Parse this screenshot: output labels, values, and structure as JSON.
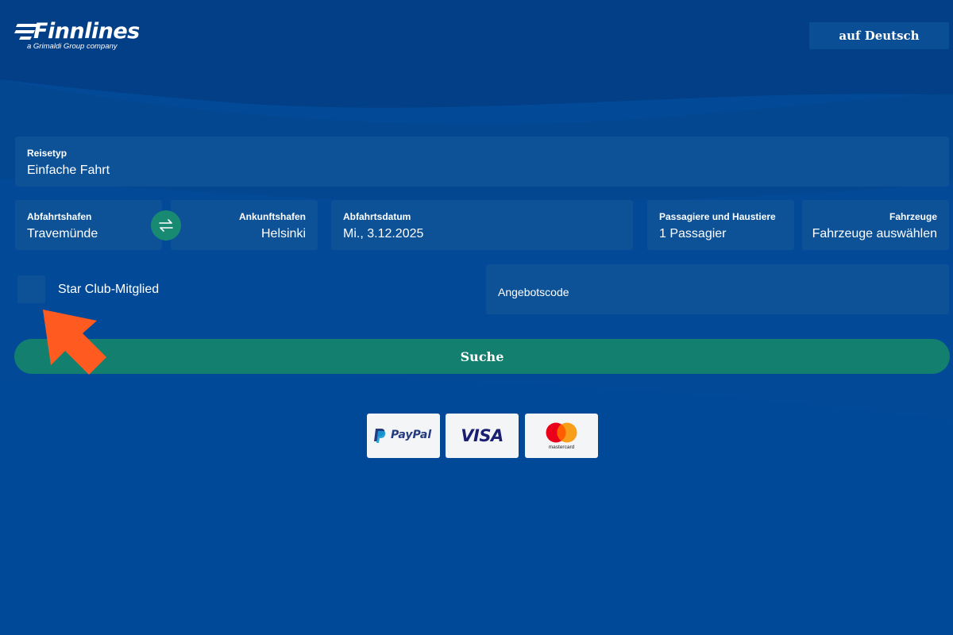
{
  "header": {
    "logo_text": "Finnlines",
    "logo_sub": "a Grimaldi Group company",
    "language_button": "auf Deutsch"
  },
  "form": {
    "trip_type": {
      "label": "Reisetyp",
      "value": "Einfache Fahrt"
    },
    "departure_port": {
      "label": "Abfahrtshafen",
      "value": "Travemünde"
    },
    "arrival_port": {
      "label": "Ankunftshafen",
      "value": "Helsinki"
    },
    "departure_date": {
      "label": "Abfahrtsdatum",
      "value": "Mi., 3.12.2025"
    },
    "passengers": {
      "label": "Passagiere und Haustiere",
      "value": "1 Passagier"
    },
    "vehicles": {
      "label": "Fahrzeuge",
      "value": "Fahrzeuge auswählen"
    },
    "star_club": {
      "label": "Star Club-Mitglied",
      "checked": false
    },
    "promo_code": {
      "placeholder": "Angebotscode"
    },
    "search_button": "Suche"
  },
  "payment_methods": [
    {
      "name": "PayPal"
    },
    {
      "name": "VISA"
    },
    {
      "name": "mastercard"
    }
  ],
  "colors": {
    "background": "#02418f",
    "field": "#0d5297",
    "accent_green": "#13806f",
    "annotation_arrow": "#ff5a1f"
  }
}
